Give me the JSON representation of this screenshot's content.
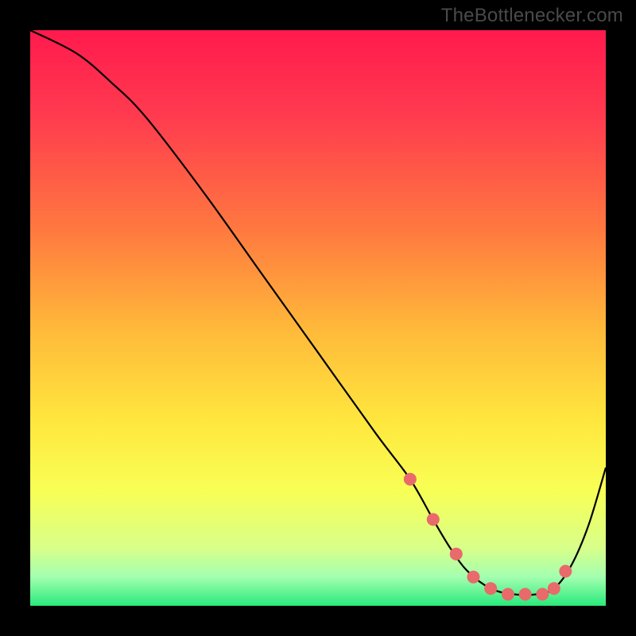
{
  "watermark": "TheBottlenecker.com",
  "chart_data": {
    "type": "line",
    "title": "",
    "xlabel": "",
    "ylabel": "",
    "xlim": [
      0,
      100
    ],
    "ylim": [
      0,
      100
    ],
    "background": {
      "type": "vertical-gradient",
      "stops": [
        {
          "pct": 0,
          "color": "#ff1a4d"
        },
        {
          "pct": 15,
          "color": "#ff3b4f"
        },
        {
          "pct": 35,
          "color": "#ff7a3f"
        },
        {
          "pct": 52,
          "color": "#ffb93a"
        },
        {
          "pct": 68,
          "color": "#ffe73e"
        },
        {
          "pct": 80,
          "color": "#f8ff55"
        },
        {
          "pct": 90,
          "color": "#d8ff8a"
        },
        {
          "pct": 95,
          "color": "#a3ffb0"
        },
        {
          "pct": 100,
          "color": "#29e97c"
        }
      ]
    },
    "series": [
      {
        "name": "bottleneck-curve",
        "color": "#000000",
        "x": [
          0,
          8,
          14,
          20,
          30,
          40,
          50,
          60,
          66,
          70,
          73,
          76,
          80,
          84,
          88,
          91,
          94,
          97,
          100
        ],
        "y": [
          100,
          96,
          91,
          85,
          72,
          58,
          44,
          30,
          22,
          15,
          10,
          6,
          3,
          2,
          2,
          3,
          7,
          14,
          24
        ]
      }
    ],
    "markers": {
      "name": "highlight-dots",
      "color": "#e96a6a",
      "x": [
        66,
        70,
        74,
        77,
        80,
        83,
        86,
        89,
        91,
        93
      ],
      "y": [
        22,
        15,
        9,
        5,
        3,
        2,
        2,
        2,
        3,
        6
      ]
    }
  }
}
